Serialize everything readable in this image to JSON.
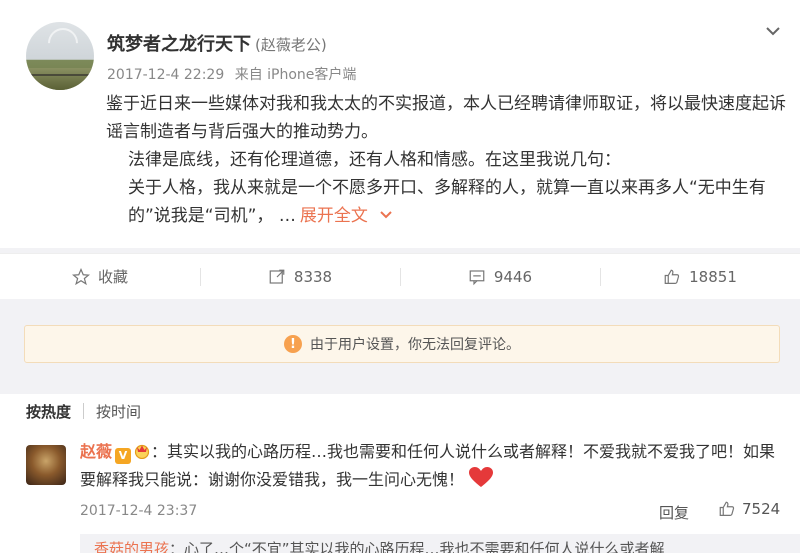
{
  "post": {
    "user_name": "筑梦者之龙行天下",
    "user_remark": "(赵薇老公)",
    "time": "2017-12-4 22:29",
    "source": "来自 iPhone客户端",
    "paragraphs": [
      "鉴于近日来一些媒体对我和我太太的不实报道，本人已经聘请律师取证，将以最快速度起诉谣言制造者与背后强大的推动势力。",
      "法律是底线，还有伦理道德，还有人格和情感。在这里我说几句：",
      "关于人格，我从来就是一个不愿多开口、多解释的人，就算一直以来再多人“无中生有的”说我是“司机”，  …"
    ],
    "expand_label": "展开全文"
  },
  "actions": {
    "favorite_label": "收藏",
    "repost_count": "8338",
    "comment_count": "9446",
    "like_count": "18851"
  },
  "notice": {
    "icon": "!",
    "text": "由于用户设置，你无法回复评论。"
  },
  "sort": {
    "hot_label": "按热度",
    "time_label": "按时间"
  },
  "comment": {
    "name": "赵薇",
    "badge": "V",
    "colon": "：",
    "text": "其实以我的心路历程…我也需要和任何人说什么或者解释！不爱我就不爱我了吧！如果要解释我只能说：谢谢你没爱错我，我一生问心无愧！",
    "time": "2017-12-4 23:37",
    "reply_label": "回复",
    "like_count": "7524"
  },
  "sub_reply": {
    "name": "香菇的男孩",
    "text": "：心了…个“不宜”其实以我的心路历程…我也不需要和任何人说什么或者解"
  },
  "colors": {
    "accent": "#eb7350",
    "notice_bg": "#fdf6ea",
    "heart": "#e5393a"
  }
}
